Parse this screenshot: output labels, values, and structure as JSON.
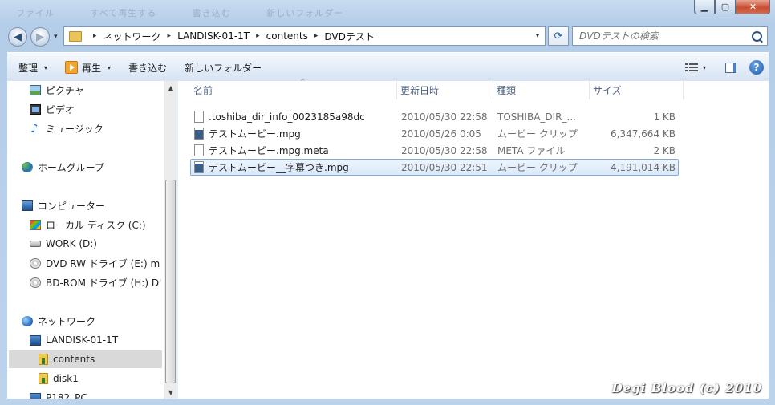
{
  "title_bar": {
    "ghost_tabs": [
      "ファイル",
      "すべて再生する",
      "書き込む",
      "新しいフォルダー"
    ],
    "minimize_glyph": "▁",
    "maximize_glyph": "▢",
    "close_glyph": "✕"
  },
  "nav": {
    "back_glyph": "◀",
    "forward_glyph": "▶",
    "recent_glyph": "▾",
    "breadcrumb": [
      "ネットワーク",
      "LANDISK-01-1T",
      "contents",
      "DVDテスト"
    ],
    "breadcrumb_sep": "▸",
    "dropdown_glyph": "▾",
    "refresh_glyph": "⟳",
    "search_placeholder": "DVDテストの検索"
  },
  "toolbar": {
    "organize_label": "整理",
    "play_label": "再生",
    "burn_label": "書き込む",
    "new_folder_label": "新しいフォルダー",
    "caret": "▾",
    "help_glyph": "?"
  },
  "sidebar": {
    "items": [
      {
        "label": "ピクチャ",
        "icon": "picture-library-icon"
      },
      {
        "label": "ビデオ",
        "icon": "video-library-icon"
      },
      {
        "label": "ミュージック",
        "icon": "music-library-icon"
      },
      {
        "label": "ホームグループ",
        "icon": "homegroup-icon"
      },
      {
        "label": "コンピューター",
        "icon": "computer-icon"
      },
      {
        "label": "ローカル ディスク (C:)",
        "icon": "windows-drive-icon"
      },
      {
        "label": "WORK (D:)",
        "icon": "hard-drive-icon"
      },
      {
        "label": "DVD RW ドライブ (E:) m",
        "icon": "dvd-drive-icon"
      },
      {
        "label": "BD-ROM ドライブ (H:) D'",
        "icon": "bd-drive-icon"
      },
      {
        "label": "ネットワーク",
        "icon": "network-icon"
      },
      {
        "label": "LANDISK-01-1T",
        "icon": "network-computer-icon"
      },
      {
        "label": "contents",
        "icon": "shared-folder-icon"
      },
      {
        "label": "disk1",
        "icon": "shared-folder-icon"
      },
      {
        "label": "P182_PC",
        "icon": "network-computer-icon"
      }
    ],
    "selected": "contents",
    "scroll_up_glyph": "▲",
    "scroll_down_glyph": "▼"
  },
  "file_list": {
    "columns": [
      "名前",
      "更新日時",
      "種類",
      "サイズ"
    ],
    "sort_glyph": "^",
    "rows": [
      {
        "name": ".toshiba_dir_info_0023185a98dc",
        "date": "2010/05/30 22:58",
        "type": "TOSHIBA_DIR_...",
        "size": "1 KB",
        "icon": "generic-file-icon"
      },
      {
        "name": "テストムービー.mpg",
        "date": "2010/05/26 0:05",
        "type": "ムービー クリップ",
        "size": "6,347,664 KB",
        "icon": "movie-file-icon"
      },
      {
        "name": "テストムービー.mpg.meta",
        "date": "2010/05/30 22:58",
        "type": "META ファイル",
        "size": "2 KB",
        "icon": "generic-file-icon"
      },
      {
        "name": "テストムービー__字幕つき.mpg",
        "date": "2010/05/30 22:51",
        "type": "ムービー クリップ",
        "size": "4,191,014 KB",
        "icon": "movie-file-icon",
        "selected": true
      }
    ]
  },
  "watermark": "Degi Blood (c) 2010"
}
